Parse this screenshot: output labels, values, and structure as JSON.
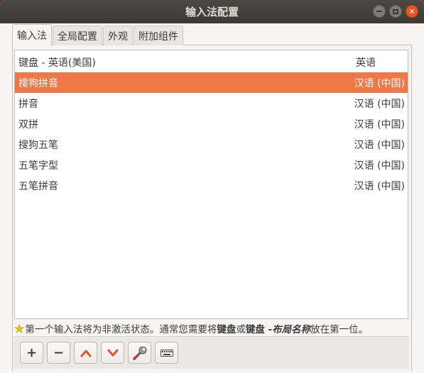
{
  "window": {
    "title": "输入法配置"
  },
  "tabs": [
    {
      "label": "输入法",
      "active": true
    },
    {
      "label": "全局配置",
      "active": false
    },
    {
      "label": "外观",
      "active": false
    },
    {
      "label": "附加组件",
      "active": false
    }
  ],
  "input_methods": [
    {
      "name": "键盘 - 英语(美国)",
      "language": "英语",
      "selected": false
    },
    {
      "name": "搜狗拼音",
      "language": "汉语 (中国)",
      "selected": true
    },
    {
      "name": "拼音",
      "language": "汉语 (中国)",
      "selected": false
    },
    {
      "name": "双拼",
      "language": "汉语 (中国)",
      "selected": false
    },
    {
      "name": "搜狗五笔",
      "language": "汉语 (中国)",
      "selected": false
    },
    {
      "name": "五笔字型",
      "language": "汉语 (中国)",
      "selected": false
    },
    {
      "name": "五笔拼音",
      "language": "汉语 (中国)",
      "selected": false
    }
  ],
  "hint": {
    "part1": "第一个输入法将为非激活状态。通常您需要将",
    "bold1": "键盘",
    "part2": "或",
    "bold2": "键盘 - ",
    "italic": "布局名称",
    "part3": "放在第一位。"
  },
  "toolbar": {
    "add_label": "+",
    "remove_label": "−"
  },
  "colors": {
    "selection": "#f07746",
    "titlebar": "#3b3a36",
    "close_button": "#e95420",
    "star": "#f5c211"
  },
  "icons": [
    "close-icon",
    "maximize-icon",
    "minimize-icon",
    "star-icon",
    "chevron-up-icon",
    "chevron-down-icon",
    "configure-icon",
    "keyboard-icon"
  ]
}
